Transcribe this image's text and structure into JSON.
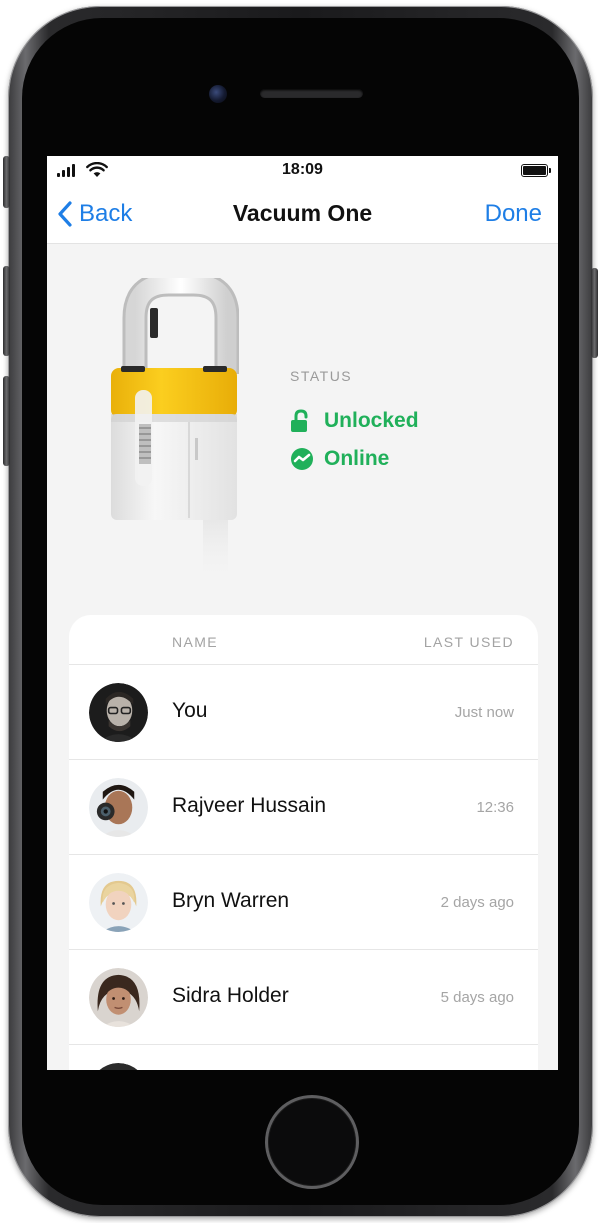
{
  "status_bar": {
    "time": "18:09",
    "icons": [
      "signal-icon",
      "wifi-icon",
      "battery-icon"
    ]
  },
  "nav": {
    "back_label": "Back",
    "title": "Vacuum One",
    "done_label": "Done"
  },
  "device": {
    "status_heading": "STATUS",
    "lock_state": "Unlocked",
    "connection_state": "Online",
    "status_color": "#20b05a",
    "accent_color": "#f5c211"
  },
  "history": {
    "col_name": "NAME",
    "col_last_used": "LAST USED",
    "rows": [
      {
        "name": "You",
        "last_used": "Just now"
      },
      {
        "name": "Rajveer Hussain",
        "last_used": "12:36"
      },
      {
        "name": "Bryn Warren",
        "last_used": "2 days ago"
      },
      {
        "name": "Sidra Holder",
        "last_used": "5 days ago"
      }
    ]
  },
  "colors": {
    "link_blue": "#1e7ee6",
    "muted_text": "#a3a3a3",
    "screen_bg": "#f4f4f4"
  }
}
